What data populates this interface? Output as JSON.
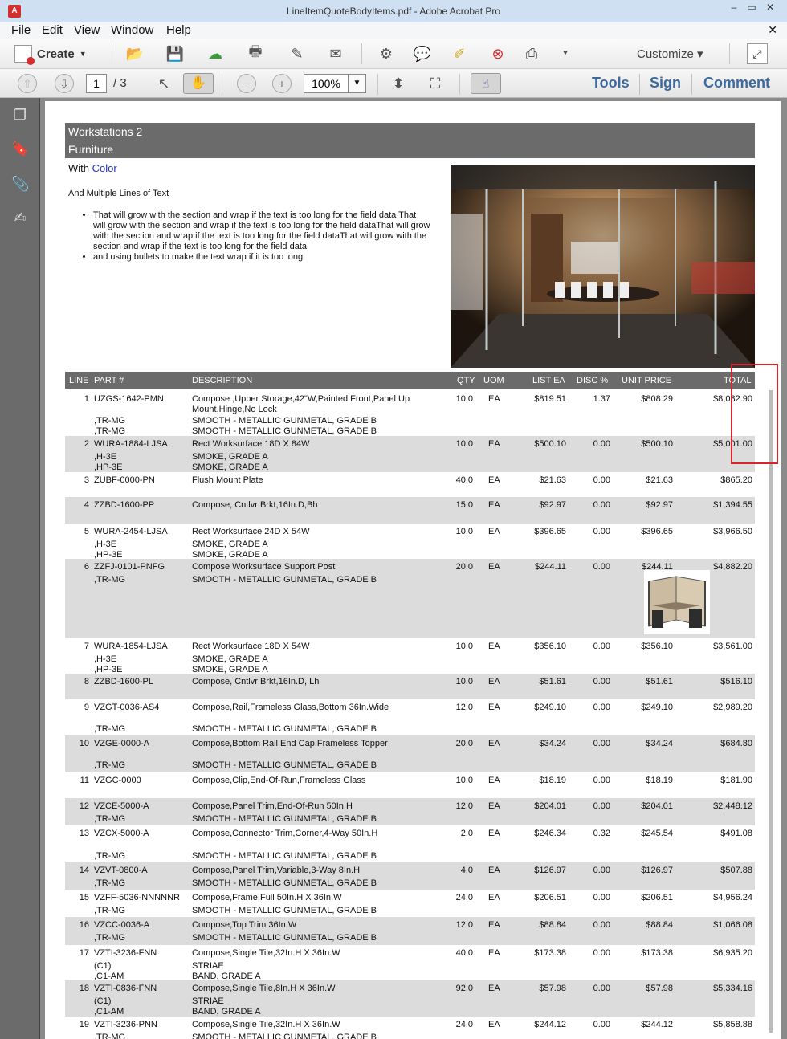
{
  "window": {
    "title": "LineItemQuoteBodyItems.pdf - Adobe Acrobat Pro",
    "icon": "pdf-icon"
  },
  "menu": {
    "items": [
      "File",
      "Edit",
      "View",
      "Window",
      "Help"
    ],
    "underline": [
      "F",
      "E",
      "V",
      "W",
      "H"
    ],
    "rest": [
      "ile",
      "dit",
      "iew",
      "indow",
      "elp"
    ]
  },
  "toolbar": {
    "create_label": "Create",
    "customize_label": "Customize",
    "page_current": "1",
    "page_total": "/ 3",
    "zoom": "100%"
  },
  "panels": {
    "tools": "Tools",
    "sign": "Sign",
    "comment": "Comment"
  },
  "document": {
    "section_title": "Workstations 2",
    "section_subtitle": "Furniture",
    "with_text": "With",
    "color_text": "Color",
    "multiple_lines": "And Multiple Lines of Text",
    "bullets": [
      "That will grow with the section and wrap if the text is too long for the field data That will grow with the section and wrap if the text is too long for the field dataThat will grow with the section and wrap if the text is too long for the field dataThat will grow with the section and wrap if the text is too long for the field data",
      "and using bullets to make the text wrap if it is too long"
    ]
  },
  "table": {
    "headers": {
      "line": "LINE",
      "part": "PART #",
      "description": "DESCRIPTION",
      "qty": "QTY",
      "uom": "UOM",
      "list": "LIST EA",
      "disc": "DISC %",
      "unit": "UNIT PRICE",
      "total": "TOTAL"
    },
    "rows": [
      {
        "line": "1",
        "part": [
          "UZGS-1642-PMN",
          "",
          ",TR-MG",
          ",TR-MG"
        ],
        "desc": [
          "Compose ,Upper Storage,42\"W,Painted Front,Panel Up",
          "Mount,Hinge,No Lock",
          "SMOOTH - METALLIC GUNMETAL, GRADE B",
          "SMOOTH - METALLIC GUNMETAL, GRADE B"
        ],
        "qty": "10.0",
        "uom": "EA",
        "list": "$819.51",
        "disc": "1.37",
        "unit": "$808.29",
        "total": "$8,082.90"
      },
      {
        "line": "2",
        "part": [
          "WURA-1884-LJSA",
          ",H-3E",
          ",HP-3E"
        ],
        "desc": [
          "Rect Worksurface 18D X 84W",
          "SMOKE, GRADE A",
          "SMOKE, GRADE A"
        ],
        "qty": "10.0",
        "uom": "EA",
        "list": "$500.10",
        "disc": "0.00",
        "unit": "$500.10",
        "total": "$5,001.00"
      },
      {
        "line": "3",
        "part": [
          "ZUBF-0000-PN"
        ],
        "desc": [
          "Flush Mount Plate"
        ],
        "qty": "40.0",
        "uom": "EA",
        "list": "$21.63",
        "disc": "0.00",
        "unit": "$21.63",
        "total": "$865.20"
      },
      {
        "line": "4",
        "part": [
          "ZZBD-1600-PP"
        ],
        "desc": [
          "Compose, Cntlvr Brkt,16In.D,Bh"
        ],
        "qty": "15.0",
        "uom": "EA",
        "list": "$92.97",
        "disc": "0.00",
        "unit": "$92.97",
        "total": "$1,394.55"
      },
      {
        "line": "5",
        "part": [
          "WURA-2454-LJSA",
          ",H-3E",
          ",HP-3E"
        ],
        "desc": [
          "Rect Worksurface 24D X 54W",
          "SMOKE, GRADE A",
          "SMOKE, GRADE A"
        ],
        "qty": "10.0",
        "uom": "EA",
        "list": "$396.65",
        "disc": "0.00",
        "unit": "$396.65",
        "total": "$3,966.50"
      },
      {
        "line": "6",
        "part": [
          "ZZFJ-0101-PNFG",
          ",TR-MG"
        ],
        "desc": [
          "Compose Worksurface Support Post",
          "SMOOTH - METALLIC GUNMETAL, GRADE B"
        ],
        "qty": "20.0",
        "uom": "EA",
        "list": "$244.11",
        "disc": "0.00",
        "unit": "$244.11",
        "total": "$4,882.20"
      },
      {
        "line": "7",
        "part": [
          "WURA-1854-LJSA",
          ",H-3E",
          ",HP-3E"
        ],
        "desc": [
          "Rect Worksurface 18D X 54W",
          "SMOKE, GRADE A",
          "SMOKE, GRADE A"
        ],
        "qty": "10.0",
        "uom": "EA",
        "list": "$356.10",
        "disc": "0.00",
        "unit": "$356.10",
        "total": "$3,561.00"
      },
      {
        "line": "8",
        "part": [
          "ZZBD-1600-PL"
        ],
        "desc": [
          "Compose, Cntlvr Brkt,16In.D, Lh"
        ],
        "qty": "10.0",
        "uom": "EA",
        "list": "$51.61",
        "disc": "0.00",
        "unit": "$51.61",
        "total": "$516.10"
      },
      {
        "line": "9",
        "part": [
          "VZGT-0036-AS4",
          "",
          ",TR-MG"
        ],
        "desc": [
          "Compose,Rail,Frameless Glass,Bottom 36In.Wide",
          "",
          "SMOOTH - METALLIC GUNMETAL, GRADE B"
        ],
        "qty": "12.0",
        "uom": "EA",
        "list": "$249.10",
        "disc": "0.00",
        "unit": "$249.10",
        "total": "$2,989.20"
      },
      {
        "line": "10",
        "part": [
          "VZGE-0000-A",
          "",
          ",TR-MG"
        ],
        "desc": [
          "Compose,Bottom Rail End Cap,Frameless Topper",
          "",
          "SMOOTH - METALLIC GUNMETAL, GRADE B"
        ],
        "qty": "20.0",
        "uom": "EA",
        "list": "$34.24",
        "disc": "0.00",
        "unit": "$34.24",
        "total": "$684.80"
      },
      {
        "line": "11",
        "part": [
          "VZGC-0000"
        ],
        "desc": [
          "Compose,Clip,End-Of-Run,Frameless Glass"
        ],
        "qty": "10.0",
        "uom": "EA",
        "list": "$18.19",
        "disc": "0.00",
        "unit": "$18.19",
        "total": "$181.90"
      },
      {
        "line": "12",
        "part": [
          "VZCE-5000-A",
          ",TR-MG"
        ],
        "desc": [
          "Compose,Panel Trim,End-Of-Run 50In.H",
          "SMOOTH - METALLIC GUNMETAL, GRADE B"
        ],
        "qty": "12.0",
        "uom": "EA",
        "list": "$204.01",
        "disc": "0.00",
        "unit": "$204.01",
        "total": "$2,448.12"
      },
      {
        "line": "13",
        "part": [
          "VZCX-5000-A",
          "",
          ",TR-MG"
        ],
        "desc": [
          "Compose,Connector Trim,Corner,4-Way 50In.H",
          "",
          "SMOOTH - METALLIC GUNMETAL, GRADE B"
        ],
        "qty": "2.0",
        "uom": "EA",
        "list": "$246.34",
        "disc": "0.32",
        "unit": "$245.54",
        "total": "$491.08"
      },
      {
        "line": "14",
        "part": [
          "VZVT-0800-A",
          ",TR-MG"
        ],
        "desc": [
          "Compose,Panel Trim,Variable,3-Way 8In.H",
          "SMOOTH - METALLIC GUNMETAL, GRADE B"
        ],
        "qty": "4.0",
        "uom": "EA",
        "list": "$126.97",
        "disc": "0.00",
        "unit": "$126.97",
        "total": "$507.88"
      },
      {
        "line": "15",
        "part": [
          "VZFF-5036-NNNNNR",
          ",TR-MG"
        ],
        "desc": [
          "Compose,Frame,Full 50In.H X 36In.W",
          "SMOOTH - METALLIC GUNMETAL, GRADE B"
        ],
        "qty": "24.0",
        "uom": "EA",
        "list": "$206.51",
        "disc": "0.00",
        "unit": "$206.51",
        "total": "$4,956.24"
      },
      {
        "line": "16",
        "part": [
          "VZCC-0036-A",
          ",TR-MG"
        ],
        "desc": [
          "Compose,Top Trim 36In.W",
          "SMOOTH - METALLIC GUNMETAL, GRADE B"
        ],
        "qty": "12.0",
        "uom": "EA",
        "list": "$88.84",
        "disc": "0.00",
        "unit": "$88.84",
        "total": "$1,066.08"
      },
      {
        "line": "17",
        "part": [
          "VZTI-3236-FNN",
          "(C1)",
          ",C1-AM"
        ],
        "desc": [
          "Compose,Single Tile,32In.H X 36In.W",
          "STRIAE",
          "BAND, GRADE A"
        ],
        "qty": "40.0",
        "uom": "EA",
        "list": "$173.38",
        "disc": "0.00",
        "unit": "$173.38",
        "total": "$6,935.20"
      },
      {
        "line": "18",
        "part": [
          "VZTI-0836-FNN",
          "(C1)",
          ",C1-AM"
        ],
        "desc": [
          "Compose,Single Tile,8In.H X 36In.W",
          "STRIAE",
          "BAND, GRADE A"
        ],
        "qty": "92.0",
        "uom": "EA",
        "list": "$57.98",
        "disc": "0.00",
        "unit": "$57.98",
        "total": "$5,334.16"
      },
      {
        "line": "19",
        "part": [
          "VZTI-3236-PNN",
          ",TR-MG"
        ],
        "desc": [
          "Compose,Single Tile,32In.H X 36In.W",
          "SMOOTH - METALLIC GUNMETAL, GRADE B"
        ],
        "qty": "24.0",
        "uom": "EA",
        "list": "$244.12",
        "disc": "0.00",
        "unit": "$244.12",
        "total": "$5,858.88"
      }
    ]
  },
  "colors": {
    "header_bar": "#6b6b6b",
    "row_shade": "#dcdcdc",
    "link_blue": "#2233bb",
    "highlight_box": "#d9232e",
    "panel_link": "#3b6aa0"
  }
}
